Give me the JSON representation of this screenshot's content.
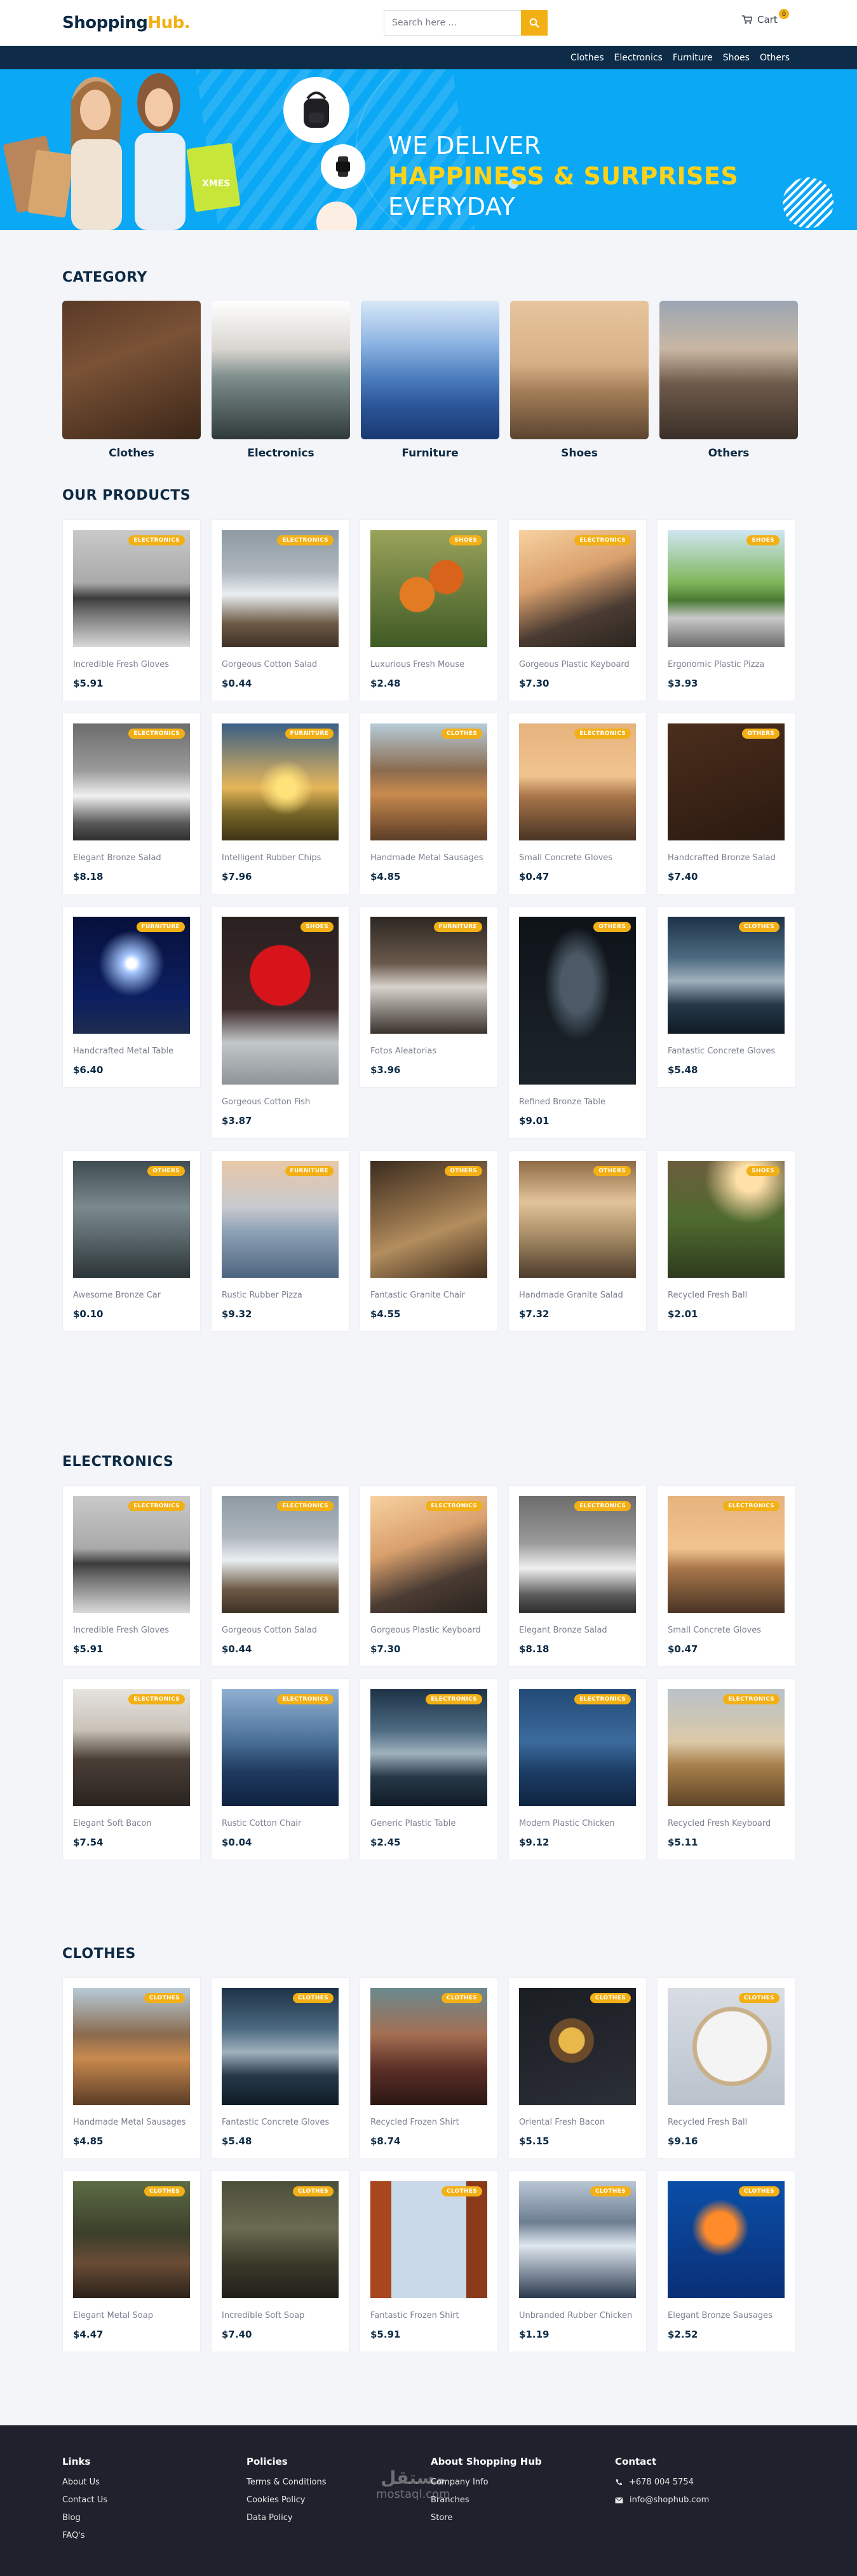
{
  "header": {
    "logo_main": "Shopping",
    "logo_accent": "Hub.",
    "search_placeholder": "Search here ...",
    "cart_label": "Cart",
    "cart_count": "0"
  },
  "nav": [
    "Clothes",
    "Electronics",
    "Furniture",
    "Shoes",
    "Others"
  ],
  "hero": {
    "line1": "WE DELIVER",
    "highlight": "HAPPINESS & SURPRISES",
    "line2_tail": "EVERYDAY",
    "bag_text": "XMES"
  },
  "colors": {
    "accent": "#f3b015",
    "navy": "#0e2c48",
    "hero_blue": "#0aa8f5",
    "footer": "#1f222c"
  },
  "categories": {
    "title": "CATEGORY",
    "items": [
      "Clothes",
      "Electronics",
      "Furniture",
      "Shoes",
      "Others"
    ]
  },
  "our_products": {
    "title": "OUR PRODUCTS",
    "items": [
      {
        "name": "Incredible Fresh Gloves",
        "price": "$5.91",
        "tag": "ELECTRONICS",
        "img": "pier"
      },
      {
        "name": "Gorgeous Cotton Salad",
        "price": "$0.44",
        "tag": "ELECTRONICS",
        "img": "snowmtn"
      },
      {
        "name": "Luxurious Fresh Mouse",
        "price": "$2.48",
        "tag": "SHOES",
        "img": "tulips"
      },
      {
        "name": "Gorgeous Plastic Keyboard",
        "price": "$7.30",
        "tag": "ELECTRONICS",
        "img": "cliff"
      },
      {
        "name": "Ergonomic Plastic Pizza",
        "price": "$3.93",
        "tag": "SHOES",
        "img": "carmirror"
      },
      {
        "name": "Elegant Bronze Salad",
        "price": "$8.18",
        "tag": "ELECTRONICS",
        "img": "eagle"
      },
      {
        "name": "Intelligent Rubber Chips",
        "price": "$7.96",
        "tag": "FURNITURE",
        "img": "sunfield"
      },
      {
        "name": "Handmade Metal Sausages",
        "price": "$4.85",
        "tag": "CLOTHES",
        "img": "boat"
      },
      {
        "name": "Small Concrete Gloves",
        "price": "$0.47",
        "tag": "ELECTRONICS",
        "img": "sunset"
      },
      {
        "name": "Handcrafted Bronze Salad",
        "price": "$7.40",
        "tag": "OTHERS",
        "img": "laptop"
      },
      {
        "name": "Handcrafted Metal Table",
        "price": "$6.40",
        "tag": "FURNITURE",
        "img": "fireworks"
      },
      {
        "name": "Gorgeous Cotton Fish",
        "price": "$3.87",
        "tag": "SHOES",
        "img": "berries",
        "tall": true
      },
      {
        "name": "Fotos Aleatorias",
        "price": "$3.96",
        "tag": "FURNITURE",
        "img": "coffee"
      },
      {
        "name": "Refined Bronze Table",
        "price": "$9.01",
        "tag": "OTHERS",
        "img": "glass",
        "tall": true
      },
      {
        "name": "Fantastic Concrete Gloves",
        "price": "$5.48",
        "tag": "CLOTHES",
        "img": "storm"
      },
      {
        "name": "Awesome Bronze Car",
        "price": "$0.10",
        "tag": "OTHERS",
        "img": "typewriter"
      },
      {
        "name": "Rustic Rubber Pizza",
        "price": "$9.32",
        "tag": "FURNITURE",
        "img": "lake"
      },
      {
        "name": "Fantastic Granite Chair",
        "price": "$4.55",
        "tag": "OTHERS",
        "img": "parcel"
      },
      {
        "name": "Handmade Granite Salad",
        "price": "$7.32",
        "tag": "OTHERS",
        "img": "station"
      },
      {
        "name": "Recycled Fresh Ball",
        "price": "$2.01",
        "tag": "SHOES",
        "img": "cactus"
      }
    ]
  },
  "electronics": {
    "title": "ELECTRONICS",
    "items": [
      {
        "name": "Incredible Fresh Gloves",
        "price": "$5.91",
        "tag": "ELECTRONICS",
        "img": "pier"
      },
      {
        "name": "Gorgeous Cotton Salad",
        "price": "$0.44",
        "tag": "ELECTRONICS",
        "img": "snowmtn"
      },
      {
        "name": "Gorgeous Plastic Keyboard",
        "price": "$7.30",
        "tag": "ELECTRONICS",
        "img": "cliff"
      },
      {
        "name": "Elegant Bronze Salad",
        "price": "$8.18",
        "tag": "ELECTRONICS",
        "img": "eagle"
      },
      {
        "name": "Small Concrete Gloves",
        "price": "$0.47",
        "tag": "ELECTRONICS",
        "img": "sunset"
      },
      {
        "name": "Elegant Soft Bacon",
        "price": "$7.54",
        "tag": "ELECTRONICS",
        "img": "cafe"
      },
      {
        "name": "Rustic Cotton Chair",
        "price": "$0.04",
        "tag": "ELECTRONICS",
        "img": "person"
      },
      {
        "name": "Generic Plastic Table",
        "price": "$2.45",
        "tag": "ELECTRONICS",
        "img": "storm"
      },
      {
        "name": "Modern Plastic Chicken",
        "price": "$9.12",
        "tag": "ELECTRONICS",
        "img": "tree"
      },
      {
        "name": "Recycled Fresh Keyboard",
        "price": "$5.11",
        "tag": "ELECTRONICS",
        "img": "dunes"
      }
    ]
  },
  "clothes": {
    "title": "CLOTHES",
    "items": [
      {
        "name": "Handmade Metal Sausages",
        "price": "$4.85",
        "tag": "CLOTHES",
        "img": "boat"
      },
      {
        "name": "Fantastic Concrete Gloves",
        "price": "$5.48",
        "tag": "CLOTHES",
        "img": "storm"
      },
      {
        "name": "Recycled Frozen Shirt",
        "price": "$8.74",
        "tag": "CLOTHES",
        "img": "road"
      },
      {
        "name": "Oriental Fresh Bacon",
        "price": "$5.15",
        "tag": "CLOTHES",
        "img": "food"
      },
      {
        "name": "Recycled Fresh Ball",
        "price": "$9.16",
        "tag": "CLOTHES",
        "img": "clock"
      },
      {
        "name": "Elegant Metal Soap",
        "price": "$4.47",
        "tag": "CLOTHES",
        "img": "wreck"
      },
      {
        "name": "Incredible Soft Soap",
        "price": "$7.40",
        "tag": "CLOTHES",
        "img": "forest"
      },
      {
        "name": "Fantastic Frozen Shirt",
        "price": "$5.91",
        "tag": "CLOTHES",
        "img": "bridge"
      },
      {
        "name": "Unbranded Rubber Chicken",
        "price": "$1.19",
        "tag": "CLOTHES",
        "img": "icemtn"
      },
      {
        "name": "Elegant Bronze Sausages",
        "price": "$2.52",
        "tag": "CLOTHES",
        "img": "jelly"
      }
    ]
  },
  "footer": {
    "links_title": "Links",
    "links": [
      "About Us",
      "Contact Us",
      "Blog",
      "FAQ's"
    ],
    "policies_title": "Policies",
    "policies": [
      "Terms & Conditions",
      "Cookies Policy",
      "Data Policy"
    ],
    "about_title": "About Shopping Hub",
    "about": [
      "Company Info",
      "Branches",
      "Store"
    ],
    "contact_title": "Contact",
    "phone": "+678 004 5754",
    "email": "info@shophub.com",
    "watermark_ar": "مستقل",
    "watermark_en": "mostaql.com"
  }
}
